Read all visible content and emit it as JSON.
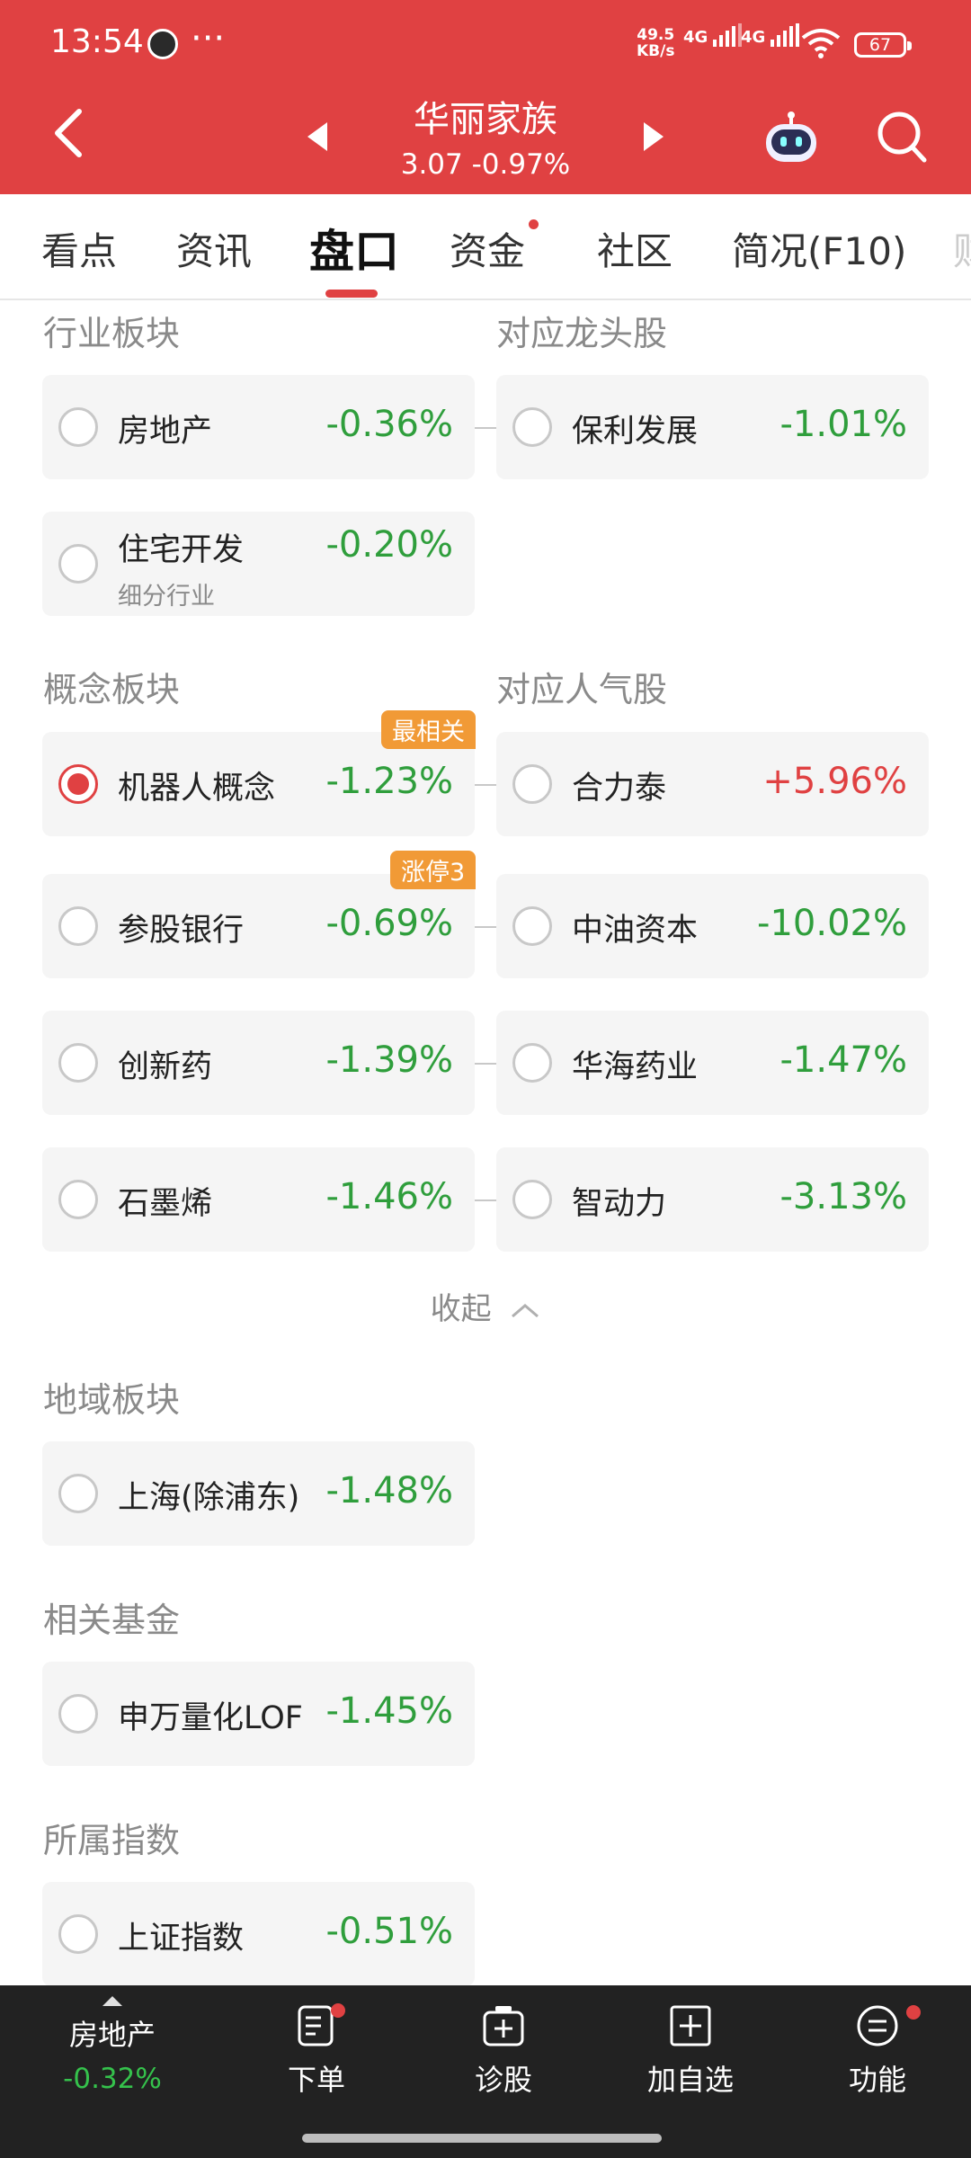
{
  "status_bar": {
    "time": "13:54",
    "net_speed_value": "49.5",
    "net_speed_unit": "KB/s",
    "net1": "4G",
    "net2": "4G",
    "battery": "67"
  },
  "header": {
    "stock_name": "华丽家族",
    "stock_price_line": "3.07 -0.97%"
  },
  "tabs": [
    {
      "label": "看点"
    },
    {
      "label": "资讯"
    },
    {
      "label": "盘口"
    },
    {
      "label": "资金"
    },
    {
      "label": "社区"
    },
    {
      "label": "简况(F10)"
    }
  ],
  "industry": {
    "title_left": "行业板块",
    "title_right": "对应龙头股",
    "rows": [
      {
        "name": "房地产",
        "value": "-0.36%",
        "leader_name": "保利发展",
        "leader_value": "-1.01%"
      },
      {
        "name": "住宅开发",
        "sub": "细分行业",
        "value": "-0.20%"
      }
    ]
  },
  "concept": {
    "title_left": "概念板块",
    "title_right": "对应人气股",
    "rows": [
      {
        "name": "机器人概念",
        "value": "-1.23%",
        "badge": "最相关",
        "selected": true,
        "pop_name": "合力泰",
        "pop_value": "+5.96%"
      },
      {
        "name": "参股银行",
        "value": "-0.69%",
        "badge": "涨停3",
        "pop_name": "中油资本",
        "pop_value": "-10.02%"
      },
      {
        "name": "创新药",
        "value": "-1.39%",
        "pop_name": "华海药业",
        "pop_value": "-1.47%"
      },
      {
        "name": "石墨烯",
        "value": "-1.46%",
        "pop_name": "智动力",
        "pop_value": "-3.13%"
      }
    ],
    "collapse_label": "收起"
  },
  "region": {
    "title": "地域板块",
    "items": [
      {
        "name": "上海(除浦东)",
        "value": "-1.48%"
      }
    ]
  },
  "fund": {
    "title": "相关基金",
    "items": [
      {
        "name": "申万量化LOF",
        "value": "-1.45%"
      }
    ]
  },
  "index": {
    "title": "所属指数",
    "items": [
      {
        "name": "上证指数",
        "value": "-0.51%"
      }
    ]
  },
  "bottom_bar": {
    "sector_name": "房地产",
    "sector_value": "-0.32%",
    "items": [
      {
        "label": "下单",
        "icon": "order-icon"
      },
      {
        "label": "诊股",
        "icon": "diagnose-icon"
      },
      {
        "label": "加自选",
        "icon": "add-watchlist-icon"
      },
      {
        "label": "功能",
        "icon": "function-icon"
      }
    ]
  },
  "colors": {
    "brand_red": "#e04142",
    "down_green": "#2f9e3c",
    "badge_orange": "#f19a36"
  }
}
